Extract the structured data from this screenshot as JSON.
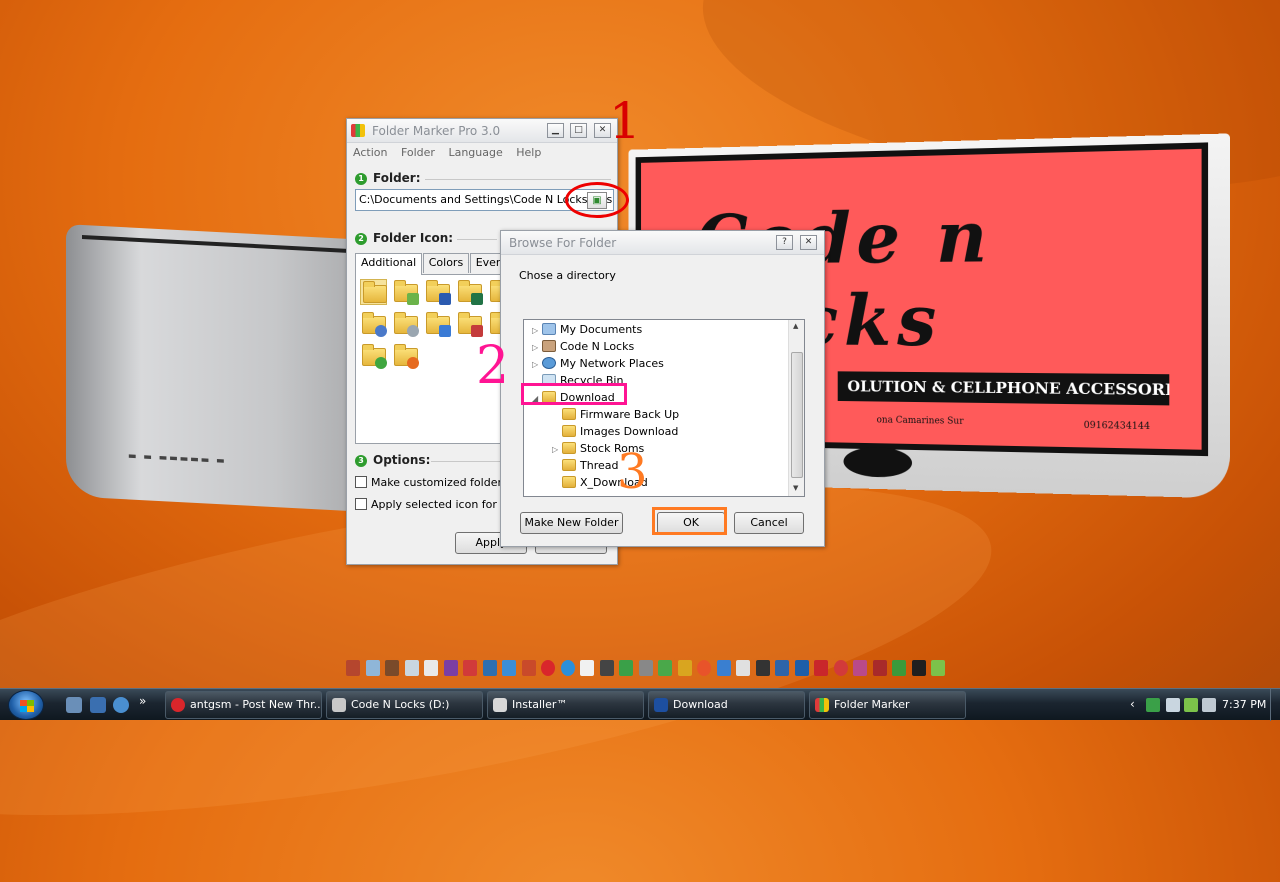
{
  "folder_marker": {
    "title": "Folder Marker Pro 3.0",
    "menu": [
      "Action",
      "Folder",
      "Language",
      "Help"
    ],
    "folder_section": "Folder:",
    "folder_path": "C:\\Documents and Settings\\Code N Locks\\Desktop",
    "icon_section": "Folder Icon:",
    "tabs": [
      "Additional",
      "Colors",
      "Everyday"
    ],
    "options_section": "Options:",
    "option_1": "Make customized folder distinctive",
    "option_2": "Apply selected icon for all subfolders",
    "apply_label": "Apply"
  },
  "browse_dialog": {
    "title": "Browse For Folder",
    "prompt": "Chose a directory",
    "tree": [
      {
        "label": "My Documents",
        "icon": "my-documents-icon",
        "level": 0,
        "expandable": true
      },
      {
        "label": "Code N Locks",
        "icon": "user-folder-icon",
        "level": 0,
        "expandable": true
      },
      {
        "label": "My Network Places",
        "icon": "network-places-icon",
        "level": 0,
        "expandable": true
      },
      {
        "label": "Recycle Bin",
        "icon": "recycle-bin-icon",
        "level": 0,
        "expandable": false
      },
      {
        "label": "Download",
        "icon": "folder-icon",
        "level": 0,
        "expanded": true,
        "selected": true
      },
      {
        "label": "Firmware Back Up",
        "icon": "folder-icon",
        "level": 1,
        "expandable": false
      },
      {
        "label": "Images Download",
        "icon": "folder-icon",
        "level": 1,
        "expandable": false
      },
      {
        "label": "Stock Roms",
        "icon": "folder-icon",
        "level": 1,
        "expandable": true
      },
      {
        "label": "Thread",
        "icon": "folder-icon",
        "level": 1,
        "expandable": false
      },
      {
        "label": "X_Download",
        "icon": "folder-icon",
        "level": 1,
        "expandable": false
      }
    ],
    "make_new_folder": "Make New Folder",
    "ok": "OK",
    "cancel": "Cancel"
  },
  "annotations": {
    "step1": "1",
    "step2": "2",
    "step3": "3"
  },
  "wallpaper": {
    "strip_text": "OLUTION & CELLPHONE ACCESSORIES",
    "sub_text": "ona Camarines Sur",
    "phone": "09162434144"
  },
  "taskbar": {
    "tasks": [
      {
        "label": "antgsm - Post New Thr...",
        "icon": "opera-icon"
      },
      {
        "label": "Code N Locks (D:)",
        "icon": "drive-icon"
      },
      {
        "label": "Installer™",
        "icon": "installer-icon"
      },
      {
        "label": "Download",
        "icon": "folder-icon"
      },
      {
        "label": "Folder Marker",
        "icon": "folder-marker-icon"
      }
    ],
    "clock": "7:37 PM",
    "chevron": "»",
    "tray_chevron": "‹"
  },
  "colors": {
    "annotation_red": "#d90000",
    "annotation_pink": "#ff1493",
    "annotation_orange": "#ff7a22",
    "wallpaper": "#e56d10"
  }
}
